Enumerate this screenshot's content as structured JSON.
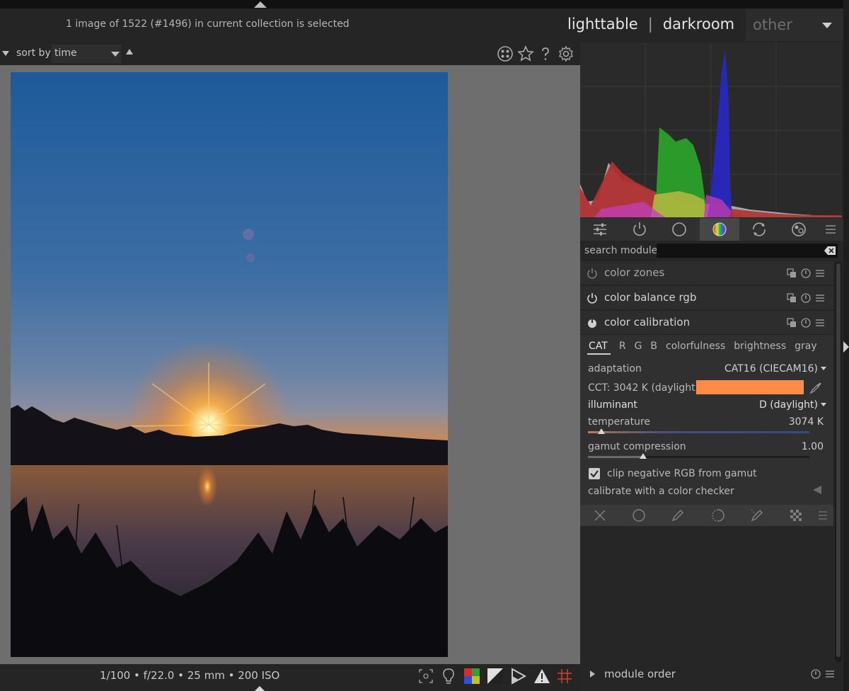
{
  "header": {
    "status": "1 image of 1522 (#1496) in current collection is selected",
    "views": {
      "lighttable": "lighttable",
      "sep1": "|",
      "darkroom": "darkroom",
      "sep2": "|",
      "other": "other"
    }
  },
  "toolbar": {
    "sort_by": "sort by",
    "sort_value": "time"
  },
  "exif": "1/100 • f/22.0 • 25 mm • 200 ISO",
  "search": {
    "label": "search module",
    "value": ""
  },
  "modules": [
    {
      "name": "color zones"
    },
    {
      "name": "color balance rgb"
    },
    {
      "name": "color calibration"
    }
  ],
  "calibration": {
    "tabs": [
      "CAT",
      "R",
      "G",
      "B",
      "colorfulness",
      "brightness",
      "gray"
    ],
    "adaptation_label": "adaptation",
    "adaptation_value": "CAT16 (CIECAM16)",
    "cct": "CCT: 3042 K (daylight)",
    "cct_color": "#fe8c48",
    "illuminant_label": "illuminant",
    "illuminant_value": "D (daylight)",
    "temperature_label": "temperature",
    "temperature_value": "3074 K",
    "temperature_fraction": 0.06,
    "gamut_label": "gamut compression",
    "gamut_value": "1.00",
    "gamut_fraction": 0.25,
    "clip_label": "clip negative RGB from gamut",
    "clip_checked": true,
    "checker_label": "calibrate with a color checker"
  },
  "module_order": "module order"
}
